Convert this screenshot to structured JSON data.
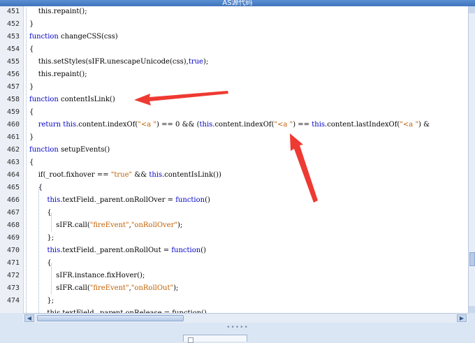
{
  "window": {
    "title": "AS源代码"
  },
  "editor": {
    "lines": [
      {
        "n": "451",
        "tokens": [
          {
            "t": "    this.repaint();",
            "c": ""
          }
        ]
      },
      {
        "n": "452",
        "tokens": [
          {
            "t": "}",
            "c": ""
          }
        ]
      },
      {
        "n": "453",
        "tokens": [
          {
            "t": "function",
            "c": "kw"
          },
          {
            "t": " changeCSS(css)",
            "c": ""
          }
        ]
      },
      {
        "n": "454",
        "tokens": [
          {
            "t": "{",
            "c": ""
          }
        ]
      },
      {
        "n": "455",
        "tokens": [
          {
            "t": "    this.setStyles(sIFR.unescapeUnicode(css),",
            "c": ""
          },
          {
            "t": "true",
            "c": "kw"
          },
          {
            "t": ");",
            "c": ""
          }
        ]
      },
      {
        "n": "456",
        "tokens": [
          {
            "t": "    this.repaint();",
            "c": ""
          }
        ]
      },
      {
        "n": "457",
        "tokens": [
          {
            "t": "}",
            "c": ""
          }
        ]
      },
      {
        "n": "458",
        "tokens": [
          {
            "t": "function",
            "c": "kw"
          },
          {
            "t": " contentIsLink()",
            "c": ""
          }
        ]
      },
      {
        "n": "459",
        "tokens": [
          {
            "t": "{",
            "c": ""
          }
        ]
      },
      {
        "n": "460",
        "tokens": [
          {
            "t": "    ",
            "c": ""
          },
          {
            "t": "return",
            "c": "kw"
          },
          {
            "t": " ",
            "c": ""
          },
          {
            "t": "this",
            "c": "kw"
          },
          {
            "t": ".content.indexOf(",
            "c": ""
          },
          {
            "t": "\"<a \"",
            "c": "str"
          },
          {
            "t": ") == 0 && (",
            "c": ""
          },
          {
            "t": "this",
            "c": "kw"
          },
          {
            "t": ".content.indexOf(",
            "c": ""
          },
          {
            "t": "\"<a \"",
            "c": "str"
          },
          {
            "t": ") == ",
            "c": ""
          },
          {
            "t": "this",
            "c": "kw"
          },
          {
            "t": ".content.lastIndexOf(",
            "c": ""
          },
          {
            "t": "\"<a \"",
            "c": "str"
          },
          {
            "t": ") &",
            "c": ""
          }
        ]
      },
      {
        "n": "461",
        "tokens": [
          {
            "t": "}",
            "c": ""
          }
        ]
      },
      {
        "n": "462",
        "tokens": [
          {
            "t": "function",
            "c": "kw"
          },
          {
            "t": " setupEvents()",
            "c": ""
          }
        ]
      },
      {
        "n": "463",
        "tokens": [
          {
            "t": "{",
            "c": ""
          }
        ]
      },
      {
        "n": "464",
        "tokens": [
          {
            "t": "    if(_root.fixhover == ",
            "c": ""
          },
          {
            "t": "\"true\"",
            "c": "str"
          },
          {
            "t": " && ",
            "c": ""
          },
          {
            "t": "this",
            "c": "kw"
          },
          {
            "t": ".contentIsLink())",
            "c": ""
          }
        ]
      },
      {
        "n": "465",
        "tokens": [
          {
            "t": "    {",
            "c": ""
          }
        ]
      },
      {
        "n": "466",
        "tokens": [
          {
            "t": "        ",
            "c": ""
          },
          {
            "t": "this",
            "c": "kw"
          },
          {
            "t": ".textField._parent.onRollOver = ",
            "c": ""
          },
          {
            "t": "function",
            "c": "kw"
          },
          {
            "t": "()",
            "c": ""
          }
        ]
      },
      {
        "n": "467",
        "tokens": [
          {
            "t": "        {",
            "c": ""
          }
        ]
      },
      {
        "n": "468",
        "tokens": [
          {
            "t": "            sIFR.call(",
            "c": ""
          },
          {
            "t": "\"fireEvent\"",
            "c": "str"
          },
          {
            "t": ",",
            "c": ""
          },
          {
            "t": "\"onRollOver\"",
            "c": "str"
          },
          {
            "t": ");",
            "c": ""
          }
        ]
      },
      {
        "n": "469",
        "tokens": [
          {
            "t": "        };",
            "c": ""
          }
        ]
      },
      {
        "n": "470",
        "tokens": [
          {
            "t": "        ",
            "c": ""
          },
          {
            "t": "this",
            "c": "kw"
          },
          {
            "t": ".textField._parent.onRollOut = ",
            "c": ""
          },
          {
            "t": "function",
            "c": "kw"
          },
          {
            "t": "()",
            "c": ""
          }
        ]
      },
      {
        "n": "471",
        "tokens": [
          {
            "t": "        {",
            "c": ""
          }
        ]
      },
      {
        "n": "472",
        "tokens": [
          {
            "t": "            sIFR.instance.fixHover();",
            "c": ""
          }
        ]
      },
      {
        "n": "473",
        "tokens": [
          {
            "t": "            sIFR.call(",
            "c": ""
          },
          {
            "t": "\"fireEvent\"",
            "c": "str"
          },
          {
            "t": ",",
            "c": ""
          },
          {
            "t": "\"onRollOut\"",
            "c": "str"
          },
          {
            "t": ");",
            "c": ""
          }
        ]
      },
      {
        "n": "474",
        "tokens": [
          {
            "t": "        };",
            "c": ""
          }
        ]
      },
      {
        "n": "",
        "tokens": [
          {
            "t": "        this.textField._parent.onRelease = function()",
            "c": ""
          }
        ]
      }
    ]
  },
  "annotations": {
    "arrow_color": "#ee3a32"
  },
  "status": {
    "grip": "•••••"
  }
}
